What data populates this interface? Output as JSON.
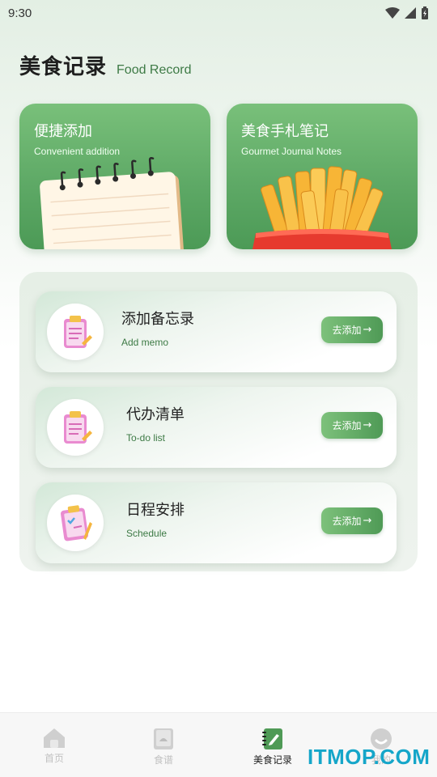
{
  "status_bar": {
    "time": "9:30"
  },
  "header": {
    "title": "美食记录",
    "subtitle": "Food Record"
  },
  "feature_cards": [
    {
      "title": "便捷添加",
      "subtitle": "Convenient addition",
      "art": "notepad-illustration"
    },
    {
      "title": "美食手札笔记",
      "subtitle": "Gourmet Journal Notes",
      "art": "french-fries-illustration"
    }
  ],
  "memo_items": [
    {
      "title": "添加备忘录",
      "subtitle": "Add memo",
      "button": "去添加",
      "icon": "clipboard-icon"
    },
    {
      "title": "代办清单",
      "subtitle": "To-do list",
      "button": "去添加",
      "icon": "clipboard-icon"
    },
    {
      "title": "日程安排",
      "subtitle": "Schedule",
      "button": "去添加",
      "icon": "checklist-icon"
    }
  ],
  "tabs": [
    {
      "label": "首页",
      "icon": "home-icon",
      "active": false
    },
    {
      "label": "食谱",
      "icon": "recipe-book-icon",
      "active": false
    },
    {
      "label": "美食记录",
      "icon": "notebook-pen-icon",
      "active": true
    },
    {
      "label": "我的",
      "icon": "profile-icon",
      "active": false
    }
  ],
  "watermark": "ITMOP.COM",
  "colors": {
    "accent": "#5ea966",
    "accent_dark": "#3d7a45",
    "watermark": "#15a6c9"
  }
}
